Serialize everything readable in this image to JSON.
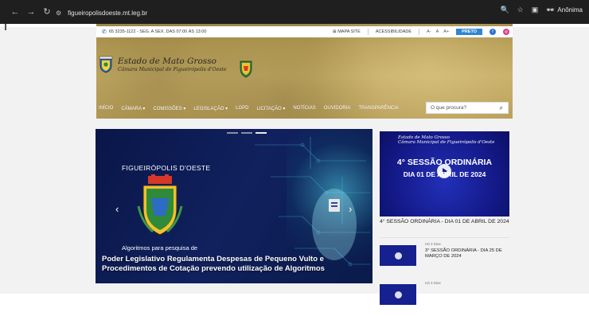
{
  "browser": {
    "url": "figueiropolisdoeste.mt.leg.br",
    "incognito_label": "Anônima"
  },
  "topbar": {
    "phone": "65 3235-1122 - SEG. A SEX. DAS 07:00 ÀS 13:00",
    "site_map": "MAPA SITE",
    "accessibility": "ACESSIBILIDADE",
    "font_decrease": "A-",
    "font_normal": "A",
    "font_increase": "A+",
    "contrast_button": "PRETO",
    "facebook": "f",
    "instagram": "◎"
  },
  "brand": {
    "title": "Estado de Mato Grosso",
    "subtitle": "Câmara Municipal de Figueirópolis d'Oeste"
  },
  "nav": {
    "items": [
      "INÍCIO",
      "CÂMARA ▾",
      "COMISSÕES ▾",
      "LEGISLAÇÃO ▾",
      "LGPD",
      "LICITAÇÃO ▾",
      "NOTÍCIAS",
      "OUVIDORIA",
      "TRANSPARÊNCIA"
    ],
    "search_placeholder": "O que procura?"
  },
  "slider": {
    "headline": "FIGUEIRÓPOLIS D'OESTE",
    "small_line": "Algoritmos para pesquisa de",
    "caption": "Poder Legislativo Regulamenta Despesas de Pequeno Vulto e Procedimentos de Cotação prevendo utilização de Algoritmos",
    "prev": "‹",
    "next": "›"
  },
  "video": {
    "header_line1": "Estado de Mato Grosso",
    "header_line2": "Câmara Municipal de Figueirópolis d'Oeste",
    "overlay_line1": "4° SESSÃO ORDINÁRIA",
    "overlay_line2": "DIA 01 DE ABRIL DE 2024",
    "title": "4° SESSÃO ORDINÁRIA - DIA 01 DE ABRIL DE 2024"
  },
  "list": [
    {
      "meta": "Há 3 Dias",
      "title": "3° SESSÃO ORDINÁRIA - DIA 25 DE MARÇO DE 2024"
    },
    {
      "meta": "Há 3 Dias",
      "title": ""
    }
  ]
}
